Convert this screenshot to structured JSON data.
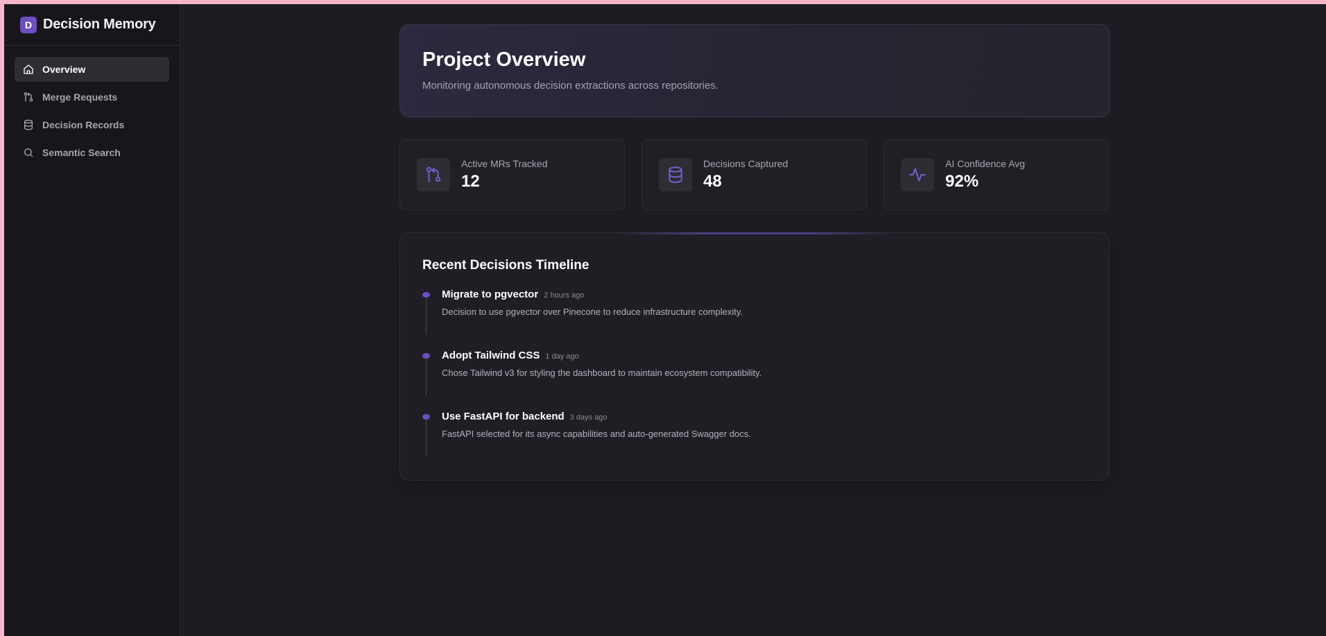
{
  "brand": {
    "logo_letter": "D",
    "name": "Decision Memory"
  },
  "sidebar": {
    "items": [
      {
        "label": "Overview",
        "icon": "home-icon",
        "active": true
      },
      {
        "label": "Merge Requests",
        "icon": "git-merge-icon",
        "active": false
      },
      {
        "label": "Decision Records",
        "icon": "database-icon",
        "active": false
      },
      {
        "label": "Semantic Search",
        "icon": "search-icon",
        "active": false
      }
    ]
  },
  "hero": {
    "title": "Project Overview",
    "subtitle": "Monitoring autonomous decision extractions across repositories."
  },
  "stats": [
    {
      "label": "Active MRs Tracked",
      "value": "12",
      "icon": "git-merge-icon"
    },
    {
      "label": "Decisions Captured",
      "value": "48",
      "icon": "database-icon"
    },
    {
      "label": "AI Confidence Avg",
      "value": "92%",
      "icon": "activity-icon"
    }
  ],
  "timeline": {
    "title": "Recent Decisions Timeline",
    "items": [
      {
        "title": "Migrate to pgvector",
        "time": "2 hours ago",
        "description": "Decision to use pgvector over Pinecone to reduce infrastructure complexity."
      },
      {
        "title": "Adopt Tailwind CSS",
        "time": "1 day ago",
        "description": "Chose Tailwind v3 for styling the dashboard to maintain ecosystem compatibility."
      },
      {
        "title": "Use FastAPI for backend",
        "time": "3 days ago",
        "description": "FastAPI selected for its async capabilities and auto-generated Swagger docs."
      }
    ]
  },
  "colors": {
    "accent": "#6d4fc2",
    "background": "#1d1c22",
    "sidebar": "#17161b",
    "card": "#201f25"
  }
}
